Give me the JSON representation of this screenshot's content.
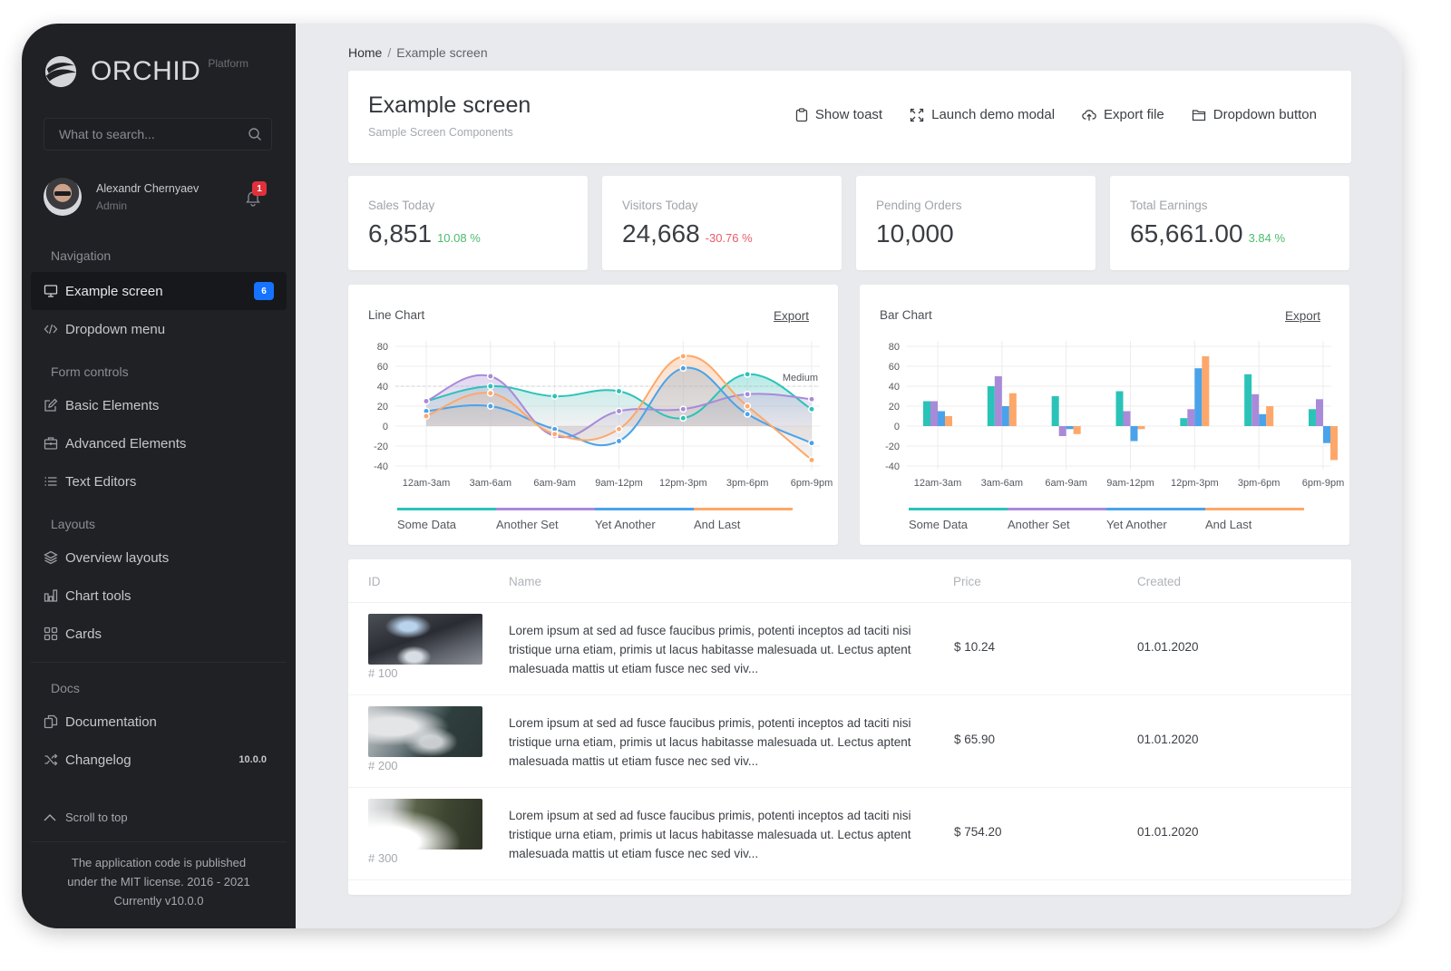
{
  "brand": {
    "name": "ORCHID",
    "subtitle": "Platform"
  },
  "search": {
    "placeholder": "What to search..."
  },
  "user": {
    "name": "Alexandr Chernyaev",
    "role": "Admin",
    "notifications": "1"
  },
  "sidebar": {
    "sections": [
      {
        "title": "Navigation",
        "items": [
          {
            "label": "Example screen",
            "icon": "monitor-icon",
            "badge": "6",
            "active": true
          },
          {
            "label": "Dropdown menu",
            "icon": "code-icon"
          }
        ]
      },
      {
        "title": "Form controls",
        "items": [
          {
            "label": "Basic Elements",
            "icon": "edit-icon"
          },
          {
            "label": "Advanced Elements",
            "icon": "briefcase-icon"
          },
          {
            "label": "Text Editors",
            "icon": "list-icon"
          }
        ]
      },
      {
        "title": "Layouts",
        "items": [
          {
            "label": "Overview layouts",
            "icon": "layers-icon"
          },
          {
            "label": "Chart tools",
            "icon": "bar-chart-icon"
          },
          {
            "label": "Cards",
            "icon": "grid-icon"
          }
        ]
      },
      {
        "title": "Docs",
        "items": [
          {
            "label": "Documentation",
            "icon": "documents-icon"
          },
          {
            "label": "Changelog",
            "icon": "shuffle-icon",
            "version": "10.0.0"
          }
        ]
      }
    ],
    "scroll_top": "Scroll to top",
    "footer": [
      "The application code is published",
      "under the MIT license. 2016 - 2021",
      "Currently v10.0.0"
    ]
  },
  "breadcrumb": {
    "home": "Home",
    "separator": "/",
    "current": "Example screen"
  },
  "header": {
    "title": "Example screen",
    "subtitle": "Sample Screen Components",
    "actions": [
      {
        "label": "Show toast",
        "icon": "clipboard-icon"
      },
      {
        "label": "Launch demo modal",
        "icon": "fullscreen-icon"
      },
      {
        "label": "Export file",
        "icon": "cloud-upload-icon"
      },
      {
        "label": "Dropdown button",
        "icon": "folder-icon"
      }
    ]
  },
  "stats": [
    {
      "label": "Sales Today",
      "value": "6,851",
      "delta": "10.08 %",
      "trend": "up"
    },
    {
      "label": "Visitors Today",
      "value": "24,668",
      "delta": "-30.76 %",
      "trend": "down"
    },
    {
      "label": "Pending Orders",
      "value": "10,000",
      "delta": "",
      "trend": "none"
    },
    {
      "label": "Total Earnings",
      "value": "65,661.00",
      "delta": "3.84 %",
      "trend": "up"
    }
  ],
  "colors": {
    "teal": "#2bc3b8",
    "purple": "#a98ad9",
    "blue": "#4aa3ea",
    "orange": "#fda86a"
  },
  "chart_data": [
    {
      "type": "line",
      "title": "Line Chart",
      "export_label": "Export",
      "categories": [
        "12am-3am",
        "3am-6am",
        "6am-9am",
        "9am-12pm",
        "12pm-3pm",
        "3pm-6pm",
        "6pm-9pm"
      ],
      "series": [
        {
          "name": "Some Data",
          "color": "#2bc3b8",
          "values": [
            25,
            40,
            30,
            35,
            8,
            52,
            17
          ]
        },
        {
          "name": "Another Set",
          "color": "#a98ad9",
          "values": [
            25,
            50,
            -10,
            15,
            17,
            32,
            27
          ]
        },
        {
          "name": "Yet Another",
          "color": "#4aa3ea",
          "values": [
            15,
            20,
            -3,
            -15,
            58,
            12,
            -17
          ]
        },
        {
          "name": "And Last",
          "color": "#fda86a",
          "values": [
            10,
            33,
            -8,
            -3,
            70,
            20,
            -34
          ]
        }
      ],
      "yticks": [
        80,
        60,
        40,
        20,
        0,
        -20,
        -40
      ],
      "ylim": [
        -40,
        80
      ],
      "marker_line": {
        "label": "Medium",
        "value": 40
      },
      "grid": true,
      "legend": "bottom"
    },
    {
      "type": "bar",
      "title": "Bar Chart",
      "export_label": "Export",
      "categories": [
        "12am-3am",
        "3am-6am",
        "6am-9am",
        "9am-12pm",
        "12pm-3pm",
        "3pm-6pm",
        "6pm-9pm"
      ],
      "series": [
        {
          "name": "Some Data",
          "color": "#2bc3b8",
          "values": [
            25,
            40,
            30,
            35,
            8,
            52,
            17
          ]
        },
        {
          "name": "Another Set",
          "color": "#a98ad9",
          "values": [
            25,
            50,
            -10,
            15,
            17,
            32,
            27
          ]
        },
        {
          "name": "Yet Another",
          "color": "#4aa3ea",
          "values": [
            15,
            20,
            -3,
            -15,
            58,
            12,
            -17
          ]
        },
        {
          "name": "And Last",
          "color": "#fda86a",
          "values": [
            10,
            33,
            -8,
            -3,
            70,
            20,
            -34
          ]
        }
      ],
      "yticks": [
        80,
        60,
        40,
        20,
        0,
        -20,
        -40
      ],
      "ylim": [
        -40,
        80
      ],
      "grid": true,
      "legend": "bottom"
    }
  ],
  "table": {
    "columns": [
      "ID",
      "Name",
      "Price",
      "Created"
    ],
    "rows": [
      {
        "id": "# 100",
        "thumb": "phone-photo",
        "name": "Lorem ipsum at sed ad fusce faucibus primis, potenti inceptos ad taciti nisi tristique urna etiam, primis ut lacus habitasse malesuada ut. Lectus aptent malesuada mattis ut etiam fusce nec sed viv...",
        "price": "$ 10.24",
        "created": "01.01.2020"
      },
      {
        "id": "# 200",
        "thumb": "mountain-clouds-photo",
        "name": "Lorem ipsum at sed ad fusce faucibus primis, potenti inceptos ad taciti nisi tristique urna etiam, primis ut lacus habitasse malesuada ut. Lectus aptent malesuada mattis ut etiam fusce nec sed viv...",
        "price": "$ 65.90",
        "created": "01.01.2020"
      },
      {
        "id": "# 300",
        "thumb": "cliff-fog-photo",
        "name": "Lorem ipsum at sed ad fusce faucibus primis, potenti inceptos ad taciti nisi tristique urna etiam, primis ut lacus habitasse malesuada ut. Lectus aptent malesuada mattis ut etiam fusce nec sed viv...",
        "price": "$ 754.20",
        "created": "01.01.2020"
      }
    ]
  }
}
